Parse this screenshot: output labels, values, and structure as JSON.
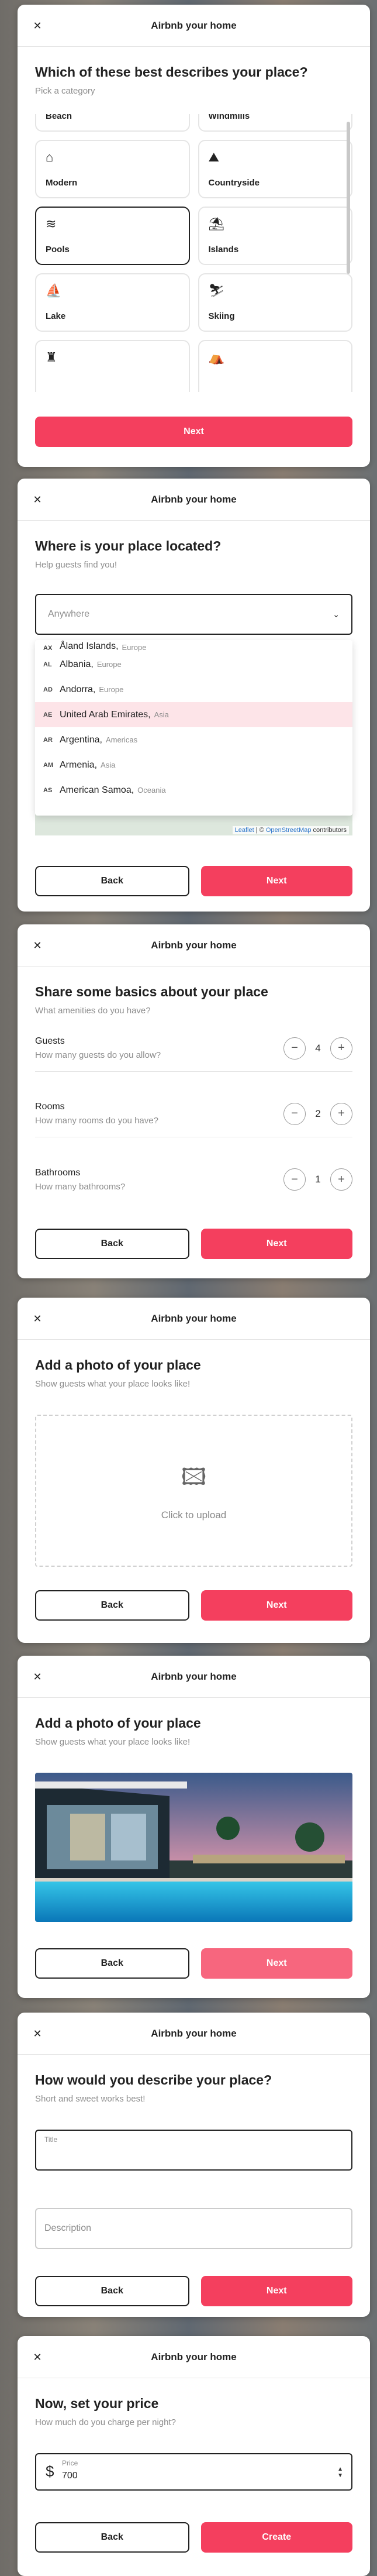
{
  "modal_title": "Airbnb your home",
  "close_glyph": "✕",
  "category_step": {
    "heading": "Which of these best describes your place?",
    "subheading": "Pick a category",
    "categories": [
      {
        "label": "Beach",
        "icon": "beach-icon",
        "glyph": "⛱"
      },
      {
        "label": "Windmills",
        "icon": "windmill-icon",
        "glyph": "✢"
      },
      {
        "label": "Modern",
        "icon": "modern-home-icon",
        "glyph": "⌂"
      },
      {
        "label": "Countryside",
        "icon": "mountain-icon",
        "glyph": "⛰"
      },
      {
        "label": "Pools",
        "icon": "pool-icon",
        "glyph": "≋"
      },
      {
        "label": "Islands",
        "icon": "island-icon",
        "glyph": "⛱"
      },
      {
        "label": "Lake",
        "icon": "lake-icon",
        "glyph": "⛵"
      },
      {
        "label": "Skiing",
        "icon": "skiing-icon",
        "glyph": "⛷"
      },
      {
        "label": "",
        "icon": "castle-icon",
        "glyph": "♜"
      },
      {
        "label": "",
        "icon": "camping-icon",
        "glyph": "⛺"
      }
    ],
    "selected": "Pools",
    "next_label": "Next"
  },
  "location_step": {
    "heading": "Where is your place located?",
    "subheading": "Help guests find you!",
    "select_placeholder": "Anywhere",
    "chevron_glyph": "⌄",
    "options": [
      {
        "code": "AX",
        "name": "Åland Islands,",
        "region": "Europe"
      },
      {
        "code": "AL",
        "name": "Albania,",
        "region": "Europe"
      },
      {
        "code": "AD",
        "name": "Andorra,",
        "region": "Europe"
      },
      {
        "code": "AE",
        "name": "United Arab Emirates,",
        "region": "Asia"
      },
      {
        "code": "AR",
        "name": "Argentina,",
        "region": "Americas"
      },
      {
        "code": "AM",
        "name": "Armenia,",
        "region": "Asia"
      },
      {
        "code": "AS",
        "name": "American Samoa,",
        "region": "Oceania"
      }
    ],
    "highlighted": "United Arab Emirates,",
    "map_credit_leaflet": "Leaflet",
    "map_credit_sep": " | © ",
    "map_credit_osm": "OpenStreetMap",
    "map_credit_tail": " contributors",
    "back_label": "Back",
    "next_label": "Next"
  },
  "info_step": {
    "heading": "Share some basics about your place",
    "subheading": "What amenities do you have?",
    "counters": [
      {
        "title": "Guests",
        "subtitle": "How many guests do you allow?",
        "value": "4"
      },
      {
        "title": "Rooms",
        "subtitle": "How many rooms do you have?",
        "value": "2"
      },
      {
        "title": "Bathrooms",
        "subtitle": "How many bathrooms?",
        "value": "1"
      }
    ],
    "minus_glyph": "−",
    "plus_glyph": "+",
    "back_label": "Back",
    "next_label": "Next"
  },
  "upload_step": {
    "heading": "Add a photo of your place",
    "subheading": "Show guests what your place looks like!",
    "upload_label": "Click to upload",
    "upload_glyph": "🖾",
    "back_label": "Back",
    "next_label": "Next"
  },
  "photo_step": {
    "heading": "Add a photo of your place",
    "subheading": "Show guests what your place looks like!",
    "back_label": "Back",
    "next_label": "Next"
  },
  "description_step": {
    "heading": "How would you describe your place?",
    "subheading": "Short and sweet works best!",
    "title_label": "Title",
    "description_placeholder": "Description",
    "back_label": "Back",
    "next_label": "Next"
  },
  "price_step": {
    "heading": "Now, set your price",
    "subheading": "How much do you charge per night?",
    "price_label": "Price",
    "price_value": "700",
    "currency_glyph": "$",
    "spin_up": "▲",
    "spin_down": "▼",
    "back_label": "Back",
    "create_label": "Create"
  },
  "colors": {
    "accent": "#f43f5e",
    "selected_border": "#222222",
    "highlight_option": "#fde4e8"
  }
}
